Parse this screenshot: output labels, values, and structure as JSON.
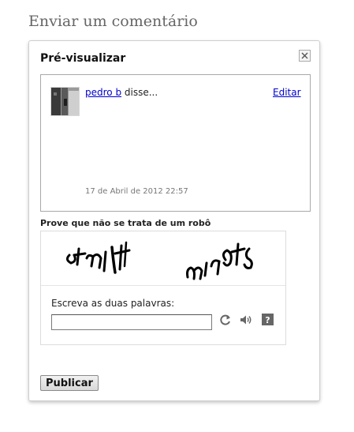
{
  "page": {
    "heading": "Enviar um comentário"
  },
  "preview": {
    "title": "Pré-visualizar",
    "close_icon": "close-icon",
    "comment": {
      "author": "pedro b",
      "said": "disse...",
      "edit_label": "Editar",
      "timestamp": "17 de Abril de 2012 22:57"
    }
  },
  "captcha": {
    "label": "Prove que não se trata de um robô",
    "words": [
      "afmit",
      "minets"
    ],
    "prompt": "Escreva as duas palavras:",
    "input_value": "",
    "icons": [
      "reload-icon",
      "audio-icon",
      "help-icon"
    ]
  },
  "actions": {
    "publish_label": "Publicar"
  }
}
